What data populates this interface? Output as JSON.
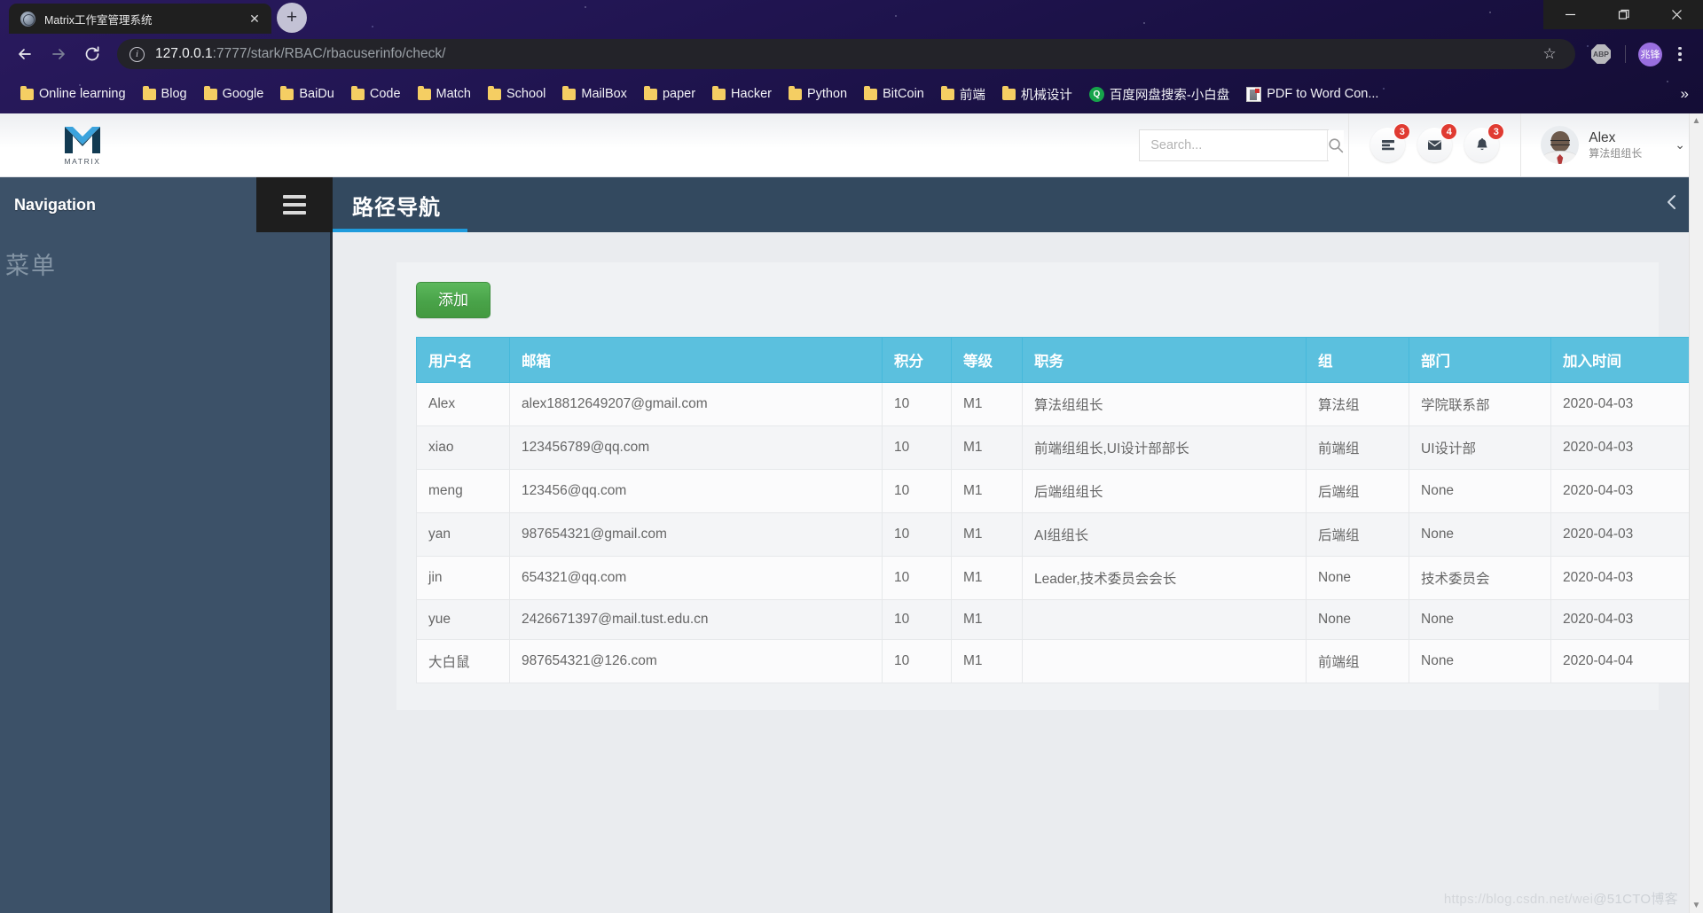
{
  "browser": {
    "tab_title": "Matrix工作室管理系统",
    "tab_close_label": "✕",
    "newtab_label": "+",
    "url_host": "127.0.0.1",
    "url_rest": ":7777/stark/RBAC/rbacuserinfo/check/",
    "info_icon_label": "i",
    "star_label": "☆",
    "abp_label": "ABP",
    "profile_initials": "兆锋",
    "overflow_label": "»",
    "window": {
      "minimize": "—",
      "maximize": "❐",
      "close": "✕"
    },
    "bookmarks": [
      {
        "label": "Online learning",
        "icon": "folder-icon"
      },
      {
        "label": "Blog",
        "icon": "folder-icon"
      },
      {
        "label": "Google",
        "icon": "folder-icon"
      },
      {
        "label": "BaiDu",
        "icon": "folder-icon"
      },
      {
        "label": "Code",
        "icon": "folder-icon"
      },
      {
        "label": "Match",
        "icon": "folder-icon"
      },
      {
        "label": "School",
        "icon": "folder-icon"
      },
      {
        "label": "MailBox",
        "icon": "folder-icon"
      },
      {
        "label": "paper",
        "icon": "folder-icon"
      },
      {
        "label": "Hacker",
        "icon": "folder-icon"
      },
      {
        "label": "Python",
        "icon": "folder-icon"
      },
      {
        "label": "BitCoin",
        "icon": "folder-icon"
      },
      {
        "label": "前端",
        "icon": "folder-icon"
      },
      {
        "label": "机械设计",
        "icon": "folder-icon"
      },
      {
        "label": "百度网盘搜索-小白盘",
        "icon": "search-circle-icon"
      },
      {
        "label": "PDF to Word Con...",
        "icon": "pdf-icon"
      }
    ]
  },
  "app": {
    "logo_text": "MATRIX",
    "search": {
      "value": "",
      "placeholder": "Search..."
    },
    "icons": [
      {
        "name": "tasks-icon",
        "badge": "3"
      },
      {
        "name": "mail-icon",
        "badge": "4"
      },
      {
        "name": "bell-icon",
        "badge": "3"
      }
    ],
    "profile": {
      "name": "Alex",
      "role": "算法组组长",
      "caret": "⌄"
    },
    "nav": {
      "sidebar_header": "Navigation",
      "menu_label": "菜单",
      "title": "路径导航",
      "collapse_icon": "chevron-left-icon"
    }
  },
  "main": {
    "add_button": "添加",
    "table": {
      "columns": [
        "用户名",
        "邮箱",
        "积分",
        "等级",
        "职务",
        "组",
        "部门",
        "加入时间"
      ],
      "rows": [
        [
          "Alex",
          "alex18812649207@gmail.com",
          "10",
          "M1",
          "算法组组长",
          "算法组",
          "学院联系部",
          "2020-04-03"
        ],
        [
          "xiao",
          "123456789@qq.com",
          "10",
          "M1",
          "前端组组长,UI设计部部长",
          "前端组",
          "UI设计部",
          "2020-04-03"
        ],
        [
          "meng",
          "123456@qq.com",
          "10",
          "M1",
          "后端组组长",
          "后端组",
          "None",
          "2020-04-03"
        ],
        [
          "yan",
          "987654321@gmail.com",
          "10",
          "M1",
          "AI组组长",
          "后端组",
          "None",
          "2020-04-03"
        ],
        [
          "jin",
          "654321@qq.com",
          "10",
          "M1",
          "Leader,技术委员会会长",
          "None",
          "技术委员会",
          "2020-04-03"
        ],
        [
          "yue",
          "2426671397@mail.tust.edu.cn",
          "10",
          "M1",
          "",
          "None",
          "None",
          "2020-04-03"
        ],
        [
          "大白鼠",
          "987654321@126.com",
          "10",
          "M1",
          "",
          "前端组",
          "None",
          "2020-04-04"
        ]
      ]
    },
    "watermark_1": "https://blog.csdn.net/wei",
    "watermark_2": "@51CTO博客"
  },
  "colors": {
    "accent_blue": "#5bc0de",
    "nav_dark": "#3c5168",
    "add_green": "#5cb85c",
    "badge_red": "#e03b32",
    "underline": "#1f9bdc"
  }
}
